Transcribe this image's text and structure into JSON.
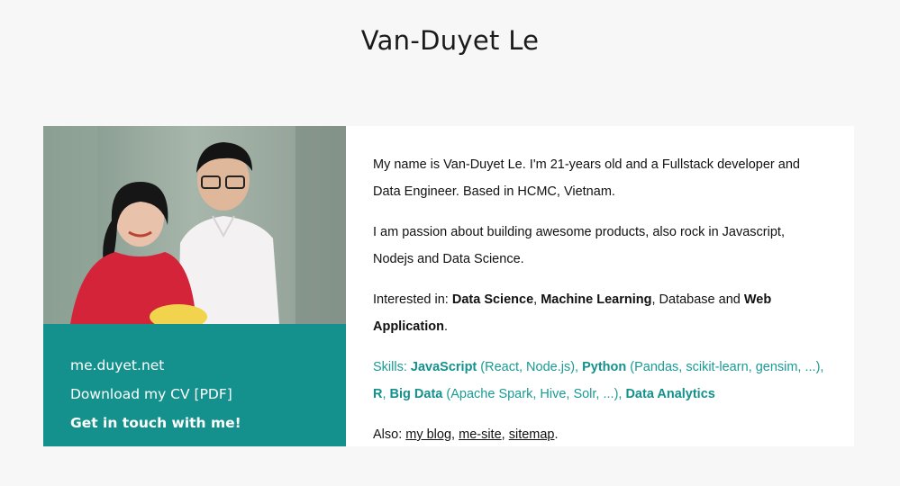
{
  "page": {
    "title": "Van-Duyet Le"
  },
  "sidebar": {
    "links": [
      {
        "label": "me.duyet.net"
      },
      {
        "label": "Download my CV [PDF]"
      }
    ],
    "cta": "Get in touch with me!"
  },
  "about": {
    "intro": "My name is Van-Duyet Le. I'm 21-years old and a Fullstack developer and Data Engineer. Based in HCMC, Vietnam.",
    "passion": "I am passion about building awesome products, also rock in Javascript, Nodejs and Data Science.",
    "interests": {
      "prefix": "Interested in: ",
      "item1": "Data Science",
      "sep1": ", ",
      "item2": "Machine Learning",
      "sep2": ", Database and ",
      "item3": "Web Application",
      "end": "."
    },
    "skills": {
      "prefix": "Skills: ",
      "s1": "JavaScript",
      "s1_detail": " (React, Node.js), ",
      "s2": "Python",
      "s2_detail": " (Pandas, scikit-learn, gensim, ...), ",
      "s3": "R",
      "s3_sep": ", ",
      "s4": "Big Data",
      "s4_detail": " (Apache Spark, Hive, Solr, ...), ",
      "s5": "Data Analytics"
    },
    "also": {
      "prefix": "Also: ",
      "link1": "my blog",
      "sep1": ", ",
      "link2": "me-site",
      "sep2": ", ",
      "link3": "sitemap",
      "end": "."
    }
  },
  "colors": {
    "accent": "#14918c",
    "background": "#f7f7f7",
    "card": "#ffffff"
  }
}
